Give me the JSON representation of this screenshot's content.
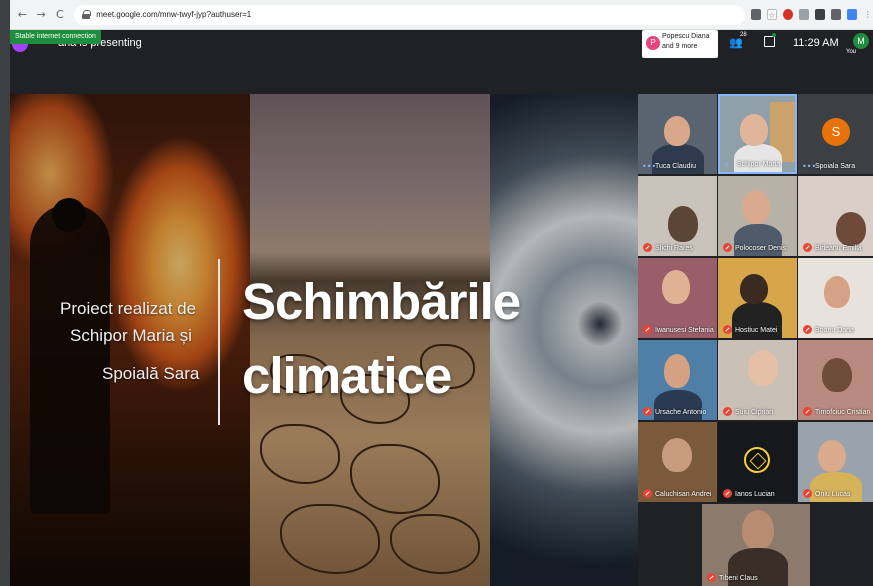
{
  "browser": {
    "url": "meet.google.com/mnw-twyf-jyp?authuser=1",
    "nav_back": "←",
    "nav_forward": "→",
    "nav_reload": "C"
  },
  "connection_status": "Stable internet connection",
  "meet": {
    "presenting_text": "aria is presenting",
    "presentation_chip": "Popescu Diana and 9 more",
    "chip_initial": "P",
    "people_count": "28",
    "clock": "11:29 AM",
    "self_initial": "M",
    "self_label": "You"
  },
  "slide": {
    "credit_line1": "Proiect realizat de",
    "credit_line2": "Schipor Maria și",
    "credit_line3": "Spoială Sara",
    "title_line1": "Schimbările",
    "title_line2": "climatice"
  },
  "participants": [
    {
      "name": "Tuca Claudiu",
      "status": "speaking"
    },
    {
      "name": "Schipor Maria",
      "status": "speaking"
    },
    {
      "name": "Spoiala Sara",
      "status": "speaking",
      "initial": "S"
    },
    {
      "name": "Sfichi Rares",
      "status": "muted"
    },
    {
      "name": "Polocoser Denis",
      "status": "muted"
    },
    {
      "name": "Birleanu Emilia",
      "status": "muted"
    },
    {
      "name": "Iwanusesi Stefania",
      "status": "muted"
    },
    {
      "name": "Hostiuc Matei",
      "status": "muted"
    },
    {
      "name": "Boanu Dana",
      "status": "muted"
    },
    {
      "name": "Ursache Antonio",
      "status": "muted"
    },
    {
      "name": "Suiu Ciprian",
      "status": "muted"
    },
    {
      "name": "Timofciuc Cristian",
      "status": "muted"
    },
    {
      "name": "Caluchisan Andrei",
      "status": "muted"
    },
    {
      "name": "Ianos Lucian",
      "status": "muted"
    },
    {
      "name": "Oniu Lucas",
      "status": "muted"
    },
    {
      "name": "Tibeni Claus",
      "status": "muted"
    }
  ],
  "colors": {
    "meet_bg": "#202124",
    "connection_green": "#1e8e3e",
    "mic_muted": "#ea4335"
  }
}
